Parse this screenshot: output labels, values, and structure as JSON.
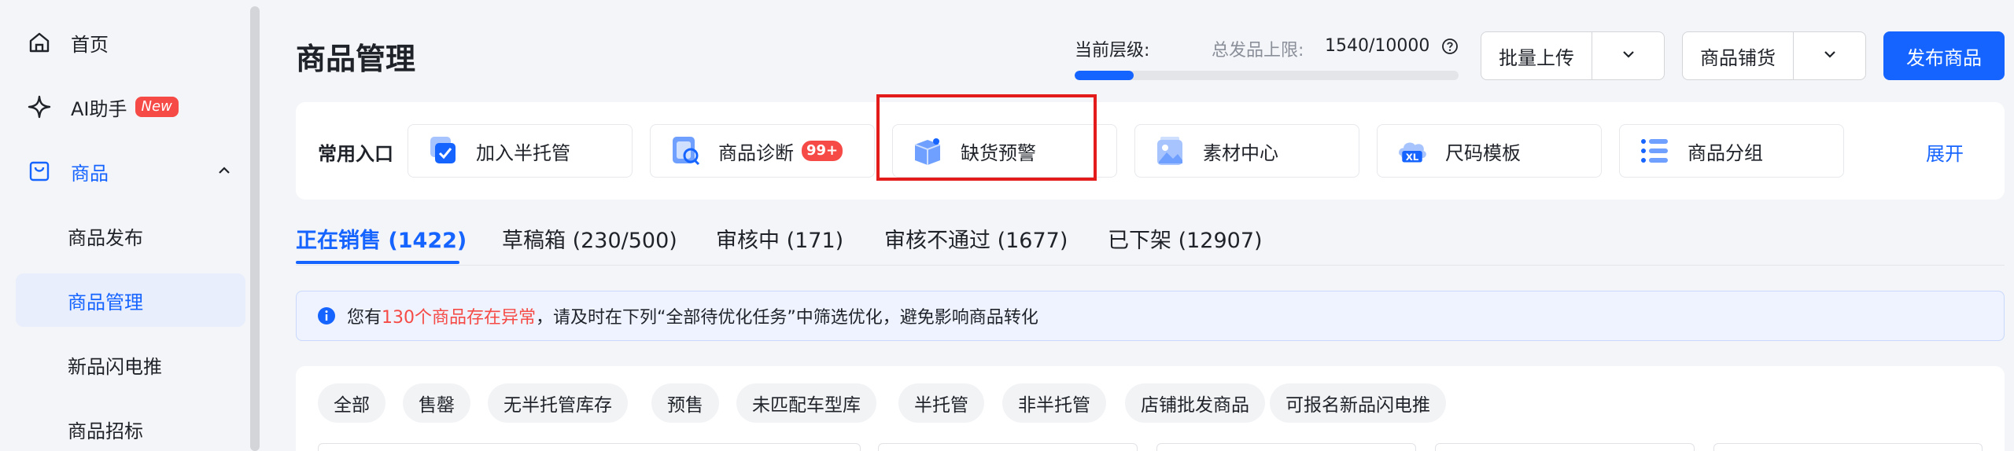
{
  "sidebar": {
    "items": [
      {
        "label": "首页",
        "icon": "home-icon"
      },
      {
        "label": "AI助手",
        "icon": "sparkle-icon",
        "badge": "New"
      },
      {
        "label": "商品",
        "icon": "bag-icon"
      },
      {
        "label": "商品发布"
      },
      {
        "label": "商品管理"
      },
      {
        "label": "新品闪电推"
      },
      {
        "label": "商品招标"
      }
    ]
  },
  "header": {
    "title": "商品管理",
    "level_label": "当前层级:",
    "limit_label": "总发品上限:",
    "limit_value": "1540/10000",
    "progress": 0.154,
    "batch_upload": "批量上传",
    "product_distribution": "商品铺货",
    "publish": "发布商品"
  },
  "shortcuts": {
    "title": "常用入口",
    "items": [
      {
        "label": "加入半托管",
        "icon": "check-box-icon"
      },
      {
        "label": "商品诊断",
        "icon": "diagnosis-icon",
        "badge": "99+"
      },
      {
        "label": "缺货预警",
        "icon": "stockout-box-icon"
      },
      {
        "label": "素材中心",
        "icon": "image-icon"
      },
      {
        "label": "尺码模板",
        "icon": "size-xl-icon"
      },
      {
        "label": "商品分组",
        "icon": "list-icon"
      }
    ],
    "expand": "展开"
  },
  "tabs": [
    {
      "label": "正在销售 (1422)"
    },
    {
      "label": "草稿箱 (230/500)"
    },
    {
      "label": "审核中 (171)"
    },
    {
      "label": "审核不通过 (1677)"
    },
    {
      "label": "已下架 (12907)"
    }
  ],
  "alert": {
    "prefix": "您有",
    "highlight": "130个商品存在异常",
    "suffix": "，请及时在下列“全部待优化任务”中筛选优化，避免影响商品转化"
  },
  "filters": [
    "全部",
    "售罄",
    "无半托管库存",
    "预售",
    "未匹配车型库",
    "半托管",
    "非半托管",
    "店铺批发商品",
    "可报名新品闪电推"
  ],
  "colors": {
    "accent": "#1664ff",
    "danger": "#f54a45",
    "highlight_border": "#e31b1b"
  }
}
